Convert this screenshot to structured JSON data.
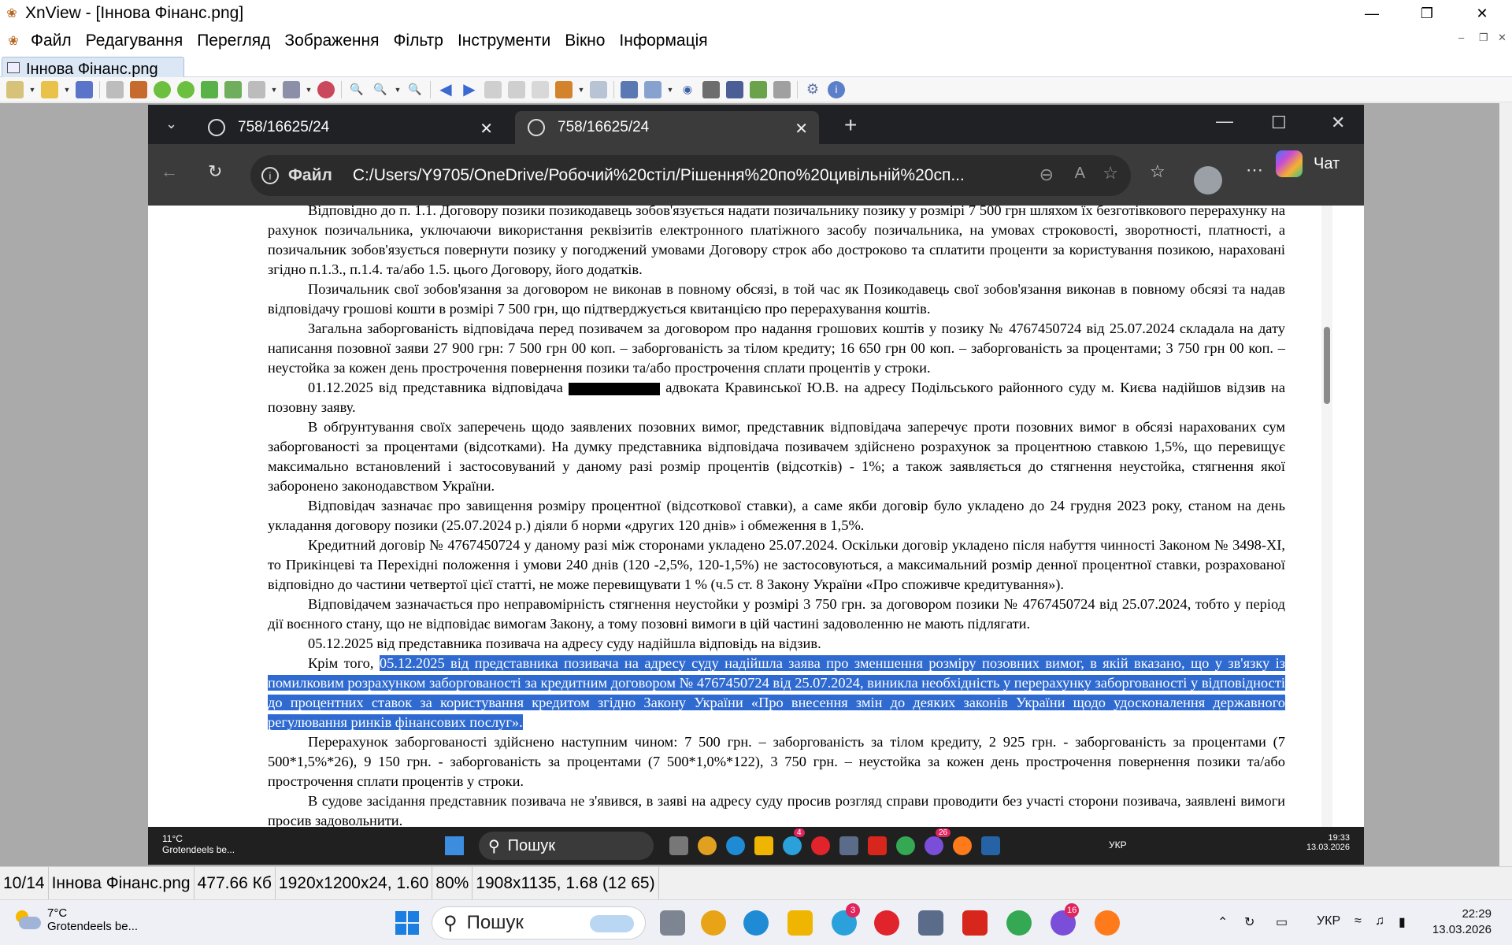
{
  "app": {
    "title": "XnView - [Іннова Фінанс.png]",
    "menu": [
      "Файл",
      "Редагування",
      "Перегляд",
      "Зображення",
      "Фільтр",
      "Інструменти",
      "Вікно",
      "Інформація"
    ],
    "tab_label": "Іннова Фінанс.png"
  },
  "browser": {
    "tabs": [
      {
        "label": "758/16625/24"
      },
      {
        "label": "758/16625/24"
      }
    ],
    "address_label": "Файл",
    "url": "C:/Users/Y9705/OneDrive/Робочий%20стіл/Рішення%20по%20цивільній%20сп...",
    "copilot_label": "Чат"
  },
  "document": {
    "p1": "Відповідно до п. 1.1. Договору позики позикодавець зобов'язується надати позичальнику позику у розмірі 7 500 грн шляхом їх безготівкового перерахунку на рахунок позичальника, уключаючи використання реквізитів електронного платіжного засобу позичальника, на умовах строковості, зворотності, платності, а позичальник зобов'язується повернути позику у погоджений умовами Договору строк або достроково та сплатити проценти за користування позикою, нараховані згідно п.1.3., п.1.4. та/або 1.5. цього Договору, його додатків.",
    "p2": "Позичальник свої зобов'язання за договором не виконав в повному обсязі, в той час як Позикодавець свої зобов'язання виконав в повному обсязі та надав відповідачу грошові кошти в розмірі 7 500 грн, що підтверджується квитанцією про перерахування коштів.",
    "p3": "Загальна заборгованість відповідача перед позивачем за договором про надання грошових коштів у позику № 4767450724 від 25.07.2024 складала на дату написання позовної заяви 27 900 грн: 7 500 грн 00 коп. – заборгованість за тілом кредиту; 16 650 грн 00 коп. – заборгованість за процентами; 3 750 грн 00 коп. – неустойка за кожен день прострочення повернення позики та/або прострочення сплати процентів у строки.",
    "p4a": "01.12.2025 від представника відповідача",
    "p4b": "адвоката Кравинської Ю.В. на адресу Подільського районного суду м. Києва надійшов відзив на позовну заяву.",
    "p5": "В обґрунтування своїх заперечень щодо заявлених позовних вимог, представник відповідача заперечує проти позовних вимог в обсязі нарахованих сум заборгованості за процентами (відсотками). На думку представника відповідача позивачем здійснено розрахунок за процентною ставкою 1,5%, що перевищує максимально встановлений і застосовуваний у даному разі розмір процентів (відсотків) - 1%; а також заявляється до стягнення неустойка, стягнення якої заборонено законодавством України.",
    "p6": "Відповідач зазначає про завищення розміру процентної (відсоткової ставки), а саме якби договір було укладено до 24 грудня 2023 року, станом на день укладання договору позики (25.07.2024 р.) діяли б норми «других 120 днів» і обмеження в 1,5%.",
    "p7": "Кредитний договір № 4767450724 у даному разі між сторонами укладено 25.07.2024. Оскільки договір укладено після набуття чинності Законом № 3498-ХІ, то Прикінцеві та Перехідні положення і умови 240 днів (120 -2,5%, 120-1,5%) не застосовуються, а максимальний розмір денної процентної ставки, розрахованої відповідно до частини четвертої цієї статті, не може перевищувати 1 % (ч.5 ст. 8 Закону України «Про споживче кредитування»).",
    "p8": "Відповідачем зазначається про неправомірність стягнення неустойки у розмірі 3 750 грн. за договором позики № 4767450724 від 25.07.2024, тобто у період дії воєнного стану, що не відповідає вимогам Закону, а тому позовні вимоги в цій частині задоволенню не мають підлягати.",
    "p9": "05.12.2025 від представника позивача на адресу суду надійшла відповідь на відзив.",
    "p10a": "Крім того,",
    "p10b": "05.12.2025 від представника позивача на адресу суду надійшла заява про зменшення розміру позовних вимог, в якій вказано, що у зв'язку із помилковим розрахунком заборгованості за кредитним договором № 4767450724 від 25.07.2024, виникла необхідність у перерахунку заборгованості у відповідності до процентних ставок за користування кредитом згідно Закону України «Про внесення змін до деяких законів України щодо удосконалення державного регулювання ринків фінансових послуг».",
    "p11": "Перерахунок заборгованості здійснено наступним чином: 7 500 грн. – заборгованість за тілом кредиту, 2 925 грн. - заборгованість за процентами (7 500*1,5%*26), 9 150 грн. - заборгованість за процентами (7 500*1,0%*122), 3 750 грн. – неустойка за кожен день прострочення повернення позики та/або прострочення сплати процентів у строки.",
    "p12": "В судове засідання представник позивача не з'явився, в заяві на адресу суду просив розгляд справи проводити без участі сторони позивача, заявлені вимоги просив задовольнити."
  },
  "inner_taskbar": {
    "temp": "11°C",
    "weather": "Grotendeels be...",
    "search": "Пошук",
    "lang": "УКР",
    "time": "19:33",
    "date": "13.03.2026",
    "badge1": "4",
    "badge2": "26"
  },
  "status": {
    "index": "10/14",
    "filename": "Іннова Фінанс.png",
    "size": "477.66 Кб",
    "dims": "1920x1200x24, 1.60",
    "zoom": "80%",
    "view": "1908x1135, 1.68 (12 65)"
  },
  "taskbar": {
    "temp": "7°C",
    "weather": "Grotendeels be...",
    "search": "Пошук",
    "lang": "УКР",
    "time": "22:29",
    "date": "13.03.2026",
    "badge_telegram": "3",
    "badge_viber": "16"
  },
  "colors": {
    "highlight": "#2f6ad0",
    "edge_dark": "#202124",
    "viewer_bg": "#aaaaaa"
  }
}
